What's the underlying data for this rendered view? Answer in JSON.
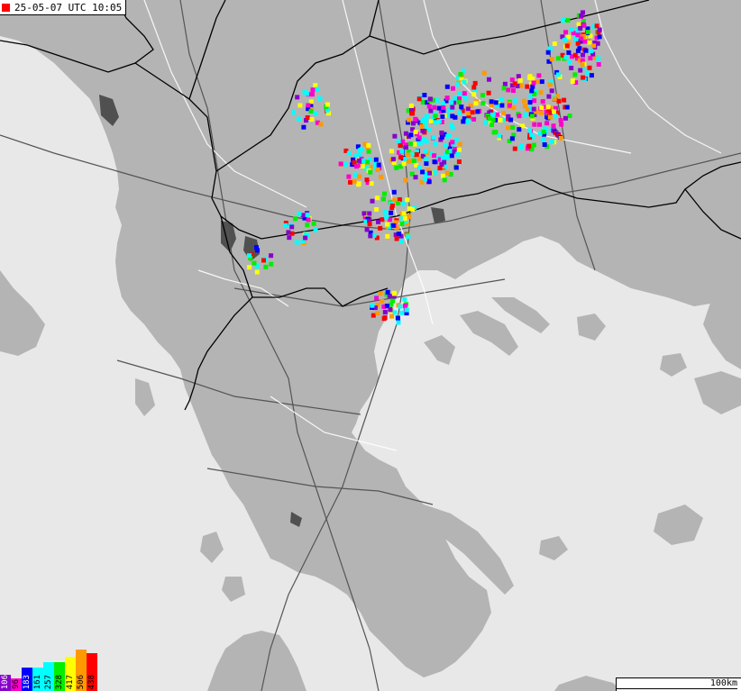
{
  "map": {
    "timestamp": "25-05-07 UTC 10:05",
    "scale_label": "100km",
    "colors": {
      "sea": "#e8e8e8",
      "land": "#b4b4b4",
      "lake": "#505050",
      "borders": "#000000",
      "roads": "#555555",
      "rivers": "#ffffff"
    }
  },
  "legend": {
    "bars": [
      {
        "label": "106",
        "color": "#8800cc"
      },
      {
        "label": "96",
        "color": "#ff00cc"
      },
      {
        "label": "183",
        "color": "#0000ff"
      },
      {
        "label": "161",
        "color": "#00ffff"
      },
      {
        "label": "257",
        "color": "#00ffff"
      },
      {
        "label": "328",
        "color": "#00ee00"
      },
      {
        "label": "417",
        "color": "#ffff00"
      },
      {
        "label": "506",
        "color": "#ff9900"
      },
      {
        "label": "438",
        "color": "#ff0000"
      }
    ]
  }
}
